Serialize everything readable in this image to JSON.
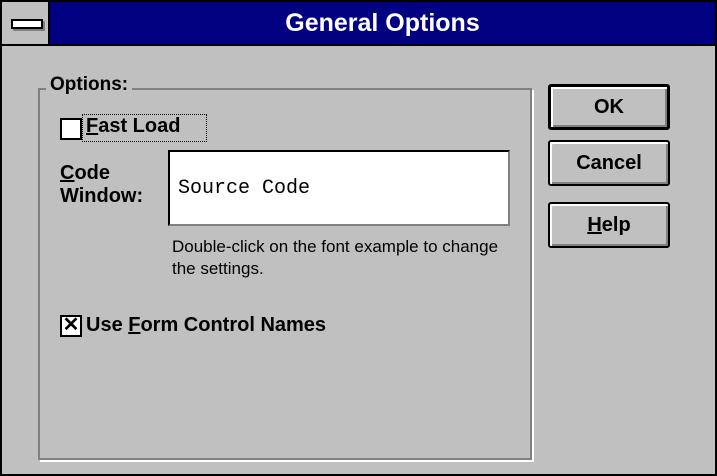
{
  "window": {
    "title": "General Options",
    "system_menu_icon": "system-menu-bar-icon"
  },
  "options_group": {
    "label": "Options:",
    "fast_load": {
      "accel": "F",
      "rest": "ast Load",
      "checked": false
    },
    "code_window": {
      "label_line1_accel": "C",
      "label_line1_rest": "ode",
      "label_line2": "Window:",
      "font_example": "Source Code",
      "hint": "Double-click on the font example to change the settings."
    },
    "use_form_control_names": {
      "label_before": "Use ",
      "accel": "F",
      "label_after": "orm Control Names",
      "checked": true,
      "check_mark": "✕"
    }
  },
  "buttons": {
    "ok": "OK",
    "cancel": "Cancel",
    "help_accel": "H",
    "help_rest": "elp"
  },
  "colors": {
    "title_bar": "#000080",
    "face": "#c0c0c0"
  }
}
